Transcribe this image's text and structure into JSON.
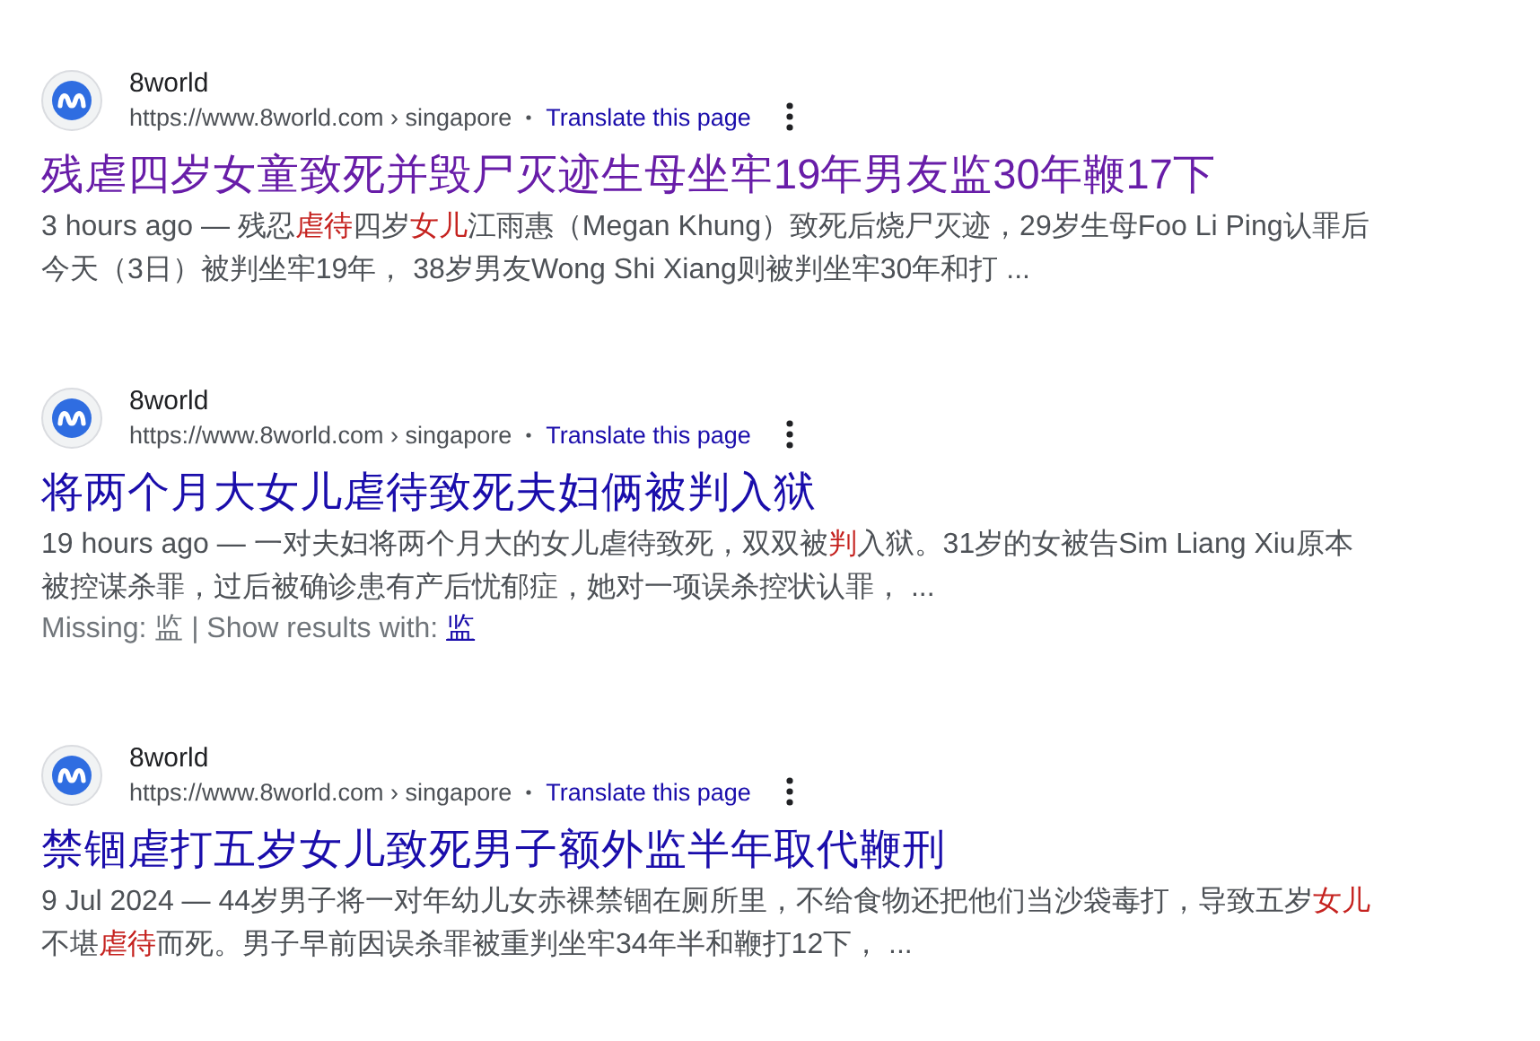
{
  "results": [
    {
      "site": "8world",
      "url": "https://www.8world.com › singapore",
      "translate": "Translate this page",
      "title": "残虐四岁女童致死并毁尸灭迹生母坐牢19年男友监30年鞭17下",
      "visited": true,
      "snippet": [
        [
          {
            "text": "3 hours ago — 残忍",
            "highlight": false
          },
          {
            "text": "虐待",
            "highlight": true
          },
          {
            "text": "四岁",
            "highlight": false
          },
          {
            "text": "女儿",
            "highlight": true
          },
          {
            "text": "江雨惠（Megan Khung）致死后烧尸灭迹，29岁生母Foo Li Ping认罪后",
            "highlight": false
          }
        ],
        [
          {
            "text": "今天（3日）被判坐牢19年， 38岁男友Wong Shi Xiang则被判坐牢30年和打 ...",
            "highlight": false
          }
        ]
      ]
    },
    {
      "site": "8world",
      "url": "https://www.8world.com › singapore",
      "translate": "Translate this page",
      "title": "将两个月大女儿虐待致死夫妇俩被判入狱",
      "visited": false,
      "snippet": [
        [
          {
            "text": "19 hours ago — 一对夫妇将两个月大的女儿虐待致死，双双被",
            "highlight": false
          },
          {
            "text": "判",
            "highlight": true
          },
          {
            "text": "入狱。31岁的女被告Sim Liang Xiu原本",
            "highlight": false
          }
        ],
        [
          {
            "text": "被控谋杀罪，过后被确诊患有产后忧郁症，她对一项误杀控状认罪，  ...",
            "highlight": false
          }
        ]
      ],
      "missing": {
        "label": "Missing: 监 | Show results with: ",
        "link": "监"
      }
    },
    {
      "site": "8world",
      "url": "https://www.8world.com › singapore",
      "translate": "Translate this page",
      "title": "禁锢虐打五岁女儿致死男子额外监半年取代鞭刑",
      "visited": false,
      "snippet": [
        [
          {
            "text": "9 Jul 2024 — 44岁男子将一对年幼儿女赤裸禁锢在厕所里，不给食物还把他们当沙袋毒打，导致五岁",
            "highlight": false
          },
          {
            "text": "女儿",
            "highlight": true
          }
        ],
        [
          {
            "text": "不堪",
            "highlight": false
          },
          {
            "text": "虐待",
            "highlight": true
          },
          {
            "text": "而死。男子早前因误杀罪被重判坐牢34年半和鞭打12下，  ...",
            "highlight": false
          }
        ]
      ]
    }
  ]
}
